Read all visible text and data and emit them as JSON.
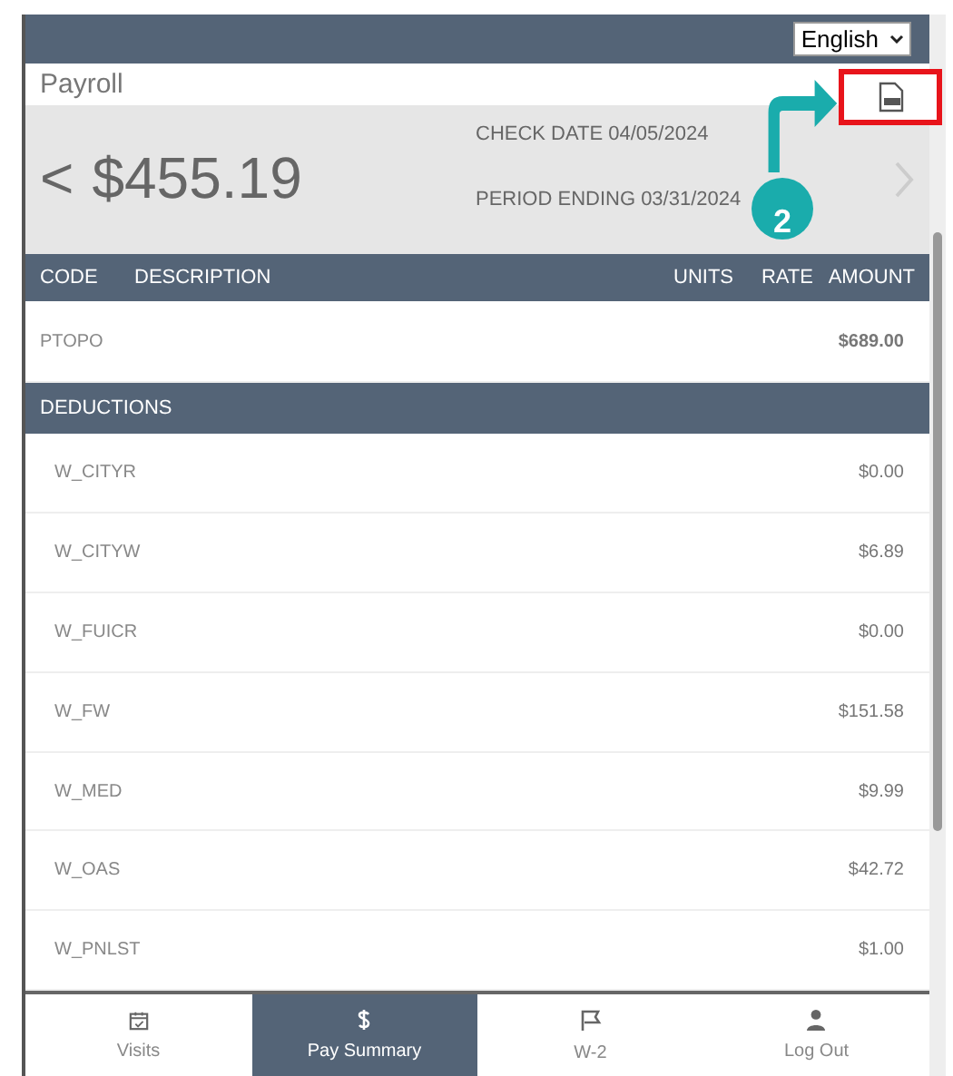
{
  "language_select": {
    "value": "English"
  },
  "header": {
    "title": "Payroll"
  },
  "summary": {
    "amount": "$455.19",
    "prev": "<",
    "check_date": "CHECK DATE 04/05/2024",
    "period_ending": "PERIOD ENDING 03/31/2024"
  },
  "table": {
    "columns": [
      "CODE",
      "DESCRIPTION",
      "UNITS",
      "RATE",
      "AMOUNT"
    ],
    "earnings": [
      {
        "code": "PTOPO",
        "amount": "$689.00"
      }
    ],
    "deductions_title": "DEDUCTIONS",
    "deductions": [
      {
        "code": "W_CITYR",
        "amount": "$0.00"
      },
      {
        "code": "W_CITYW",
        "amount": "$6.89"
      },
      {
        "code": "W_FUICR",
        "amount": "$0.00"
      },
      {
        "code": "W_FW",
        "amount": "$151.58"
      },
      {
        "code": "W_MED",
        "amount": "$9.99"
      },
      {
        "code": "W_OAS",
        "amount": "$42.72"
      },
      {
        "code": "W_PNLST",
        "amount": "$1.00"
      }
    ]
  },
  "nav": [
    {
      "label": "Visits",
      "kind": "calendar",
      "selected": false
    },
    {
      "label": "Pay Summary",
      "kind": "dollar",
      "selected": true
    },
    {
      "label": "W-2",
      "kind": "flag",
      "selected": false
    },
    {
      "label": "Log Out",
      "kind": "user",
      "selected": false
    }
  ],
  "annotation": {
    "step": "2"
  }
}
